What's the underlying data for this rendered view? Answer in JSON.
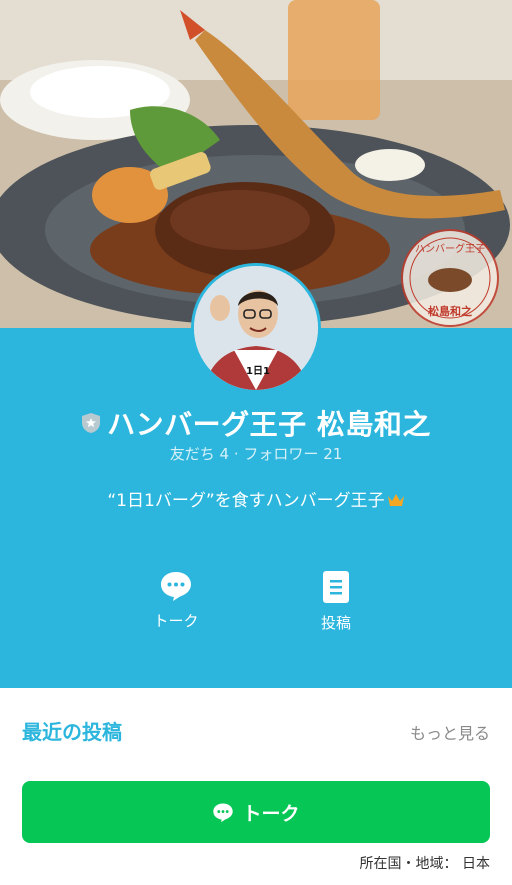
{
  "colors": {
    "profile_bg": "#2cb6dd",
    "talk_button": "#06c755",
    "recent_title": "#2cb6dd"
  },
  "cover": {
    "image": "hamburg-steak-and-fried-shrimp-plate",
    "stamp_text_top": "ハンバーグ王子",
    "stamp_text_bottom": "松島和之"
  },
  "profile": {
    "avatar": "profile-photo-man-with-glasses",
    "verified_badge": "shield-star-icon",
    "name": "ハンバーグ王子 松島和之",
    "friends_label": "友だち",
    "friends_count": "4",
    "followers_label": "フォロワー",
    "followers_count": "21",
    "separator": "·",
    "status_message": "“1日1バーグ”を食すハンバーグ王子",
    "status_icon": "crown-icon"
  },
  "actions": [
    {
      "label": "トーク",
      "icon": "chat-bubble-icon"
    },
    {
      "label": "投稿",
      "icon": "post-document-icon"
    }
  ],
  "recent": {
    "title": "最近の投稿",
    "more_label": "もっと見る"
  },
  "talk_button": {
    "label": "トーク",
    "icon": "chat-bubble-icon"
  },
  "region": {
    "label": "所在国・地域：",
    "value": "日本"
  }
}
